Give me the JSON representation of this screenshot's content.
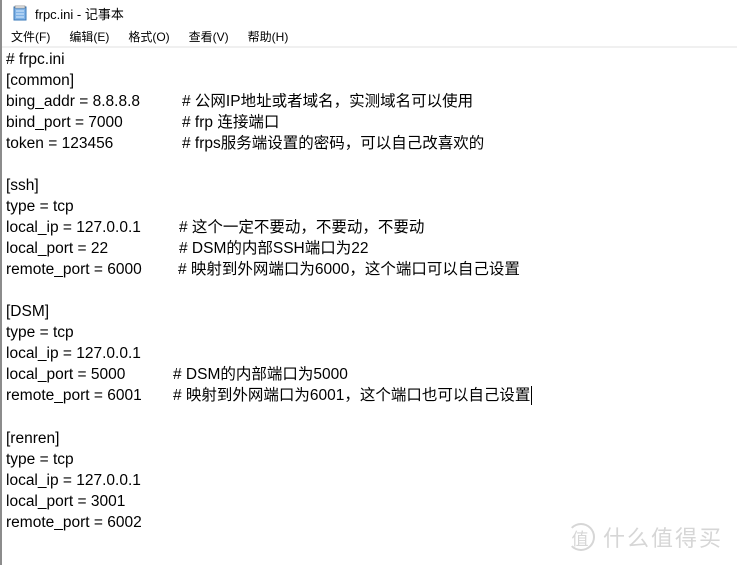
{
  "window": {
    "title": "frpc.ini - 记事本",
    "app_icon": "notepad-icon"
  },
  "menu": [
    {
      "label": "文件(F)"
    },
    {
      "label": "编辑(E)"
    },
    {
      "label": "格式(O)"
    },
    {
      "label": "查看(V)"
    },
    {
      "label": "帮助(H)"
    }
  ],
  "editor": {
    "lines": [
      {
        "text": "# frpc.ini",
        "comment": ""
      },
      {
        "text": "[common]",
        "comment": ""
      },
      {
        "text": "bing_addr = 8.8.8.8",
        "comment": "# 公网IP地址或者域名，实测域名可以使用"
      },
      {
        "text": "bind_port = 7000",
        "comment": "# frp 连接端口"
      },
      {
        "text": "token = 123456",
        "comment": "# frps服务端设置的密码，可以自己改喜欢的"
      },
      {
        "text": "",
        "comment": ""
      },
      {
        "text": "[ssh]",
        "comment": ""
      },
      {
        "text": "type = tcp",
        "comment": ""
      },
      {
        "text": "local_ip = 127.0.0.1",
        "comment": "# 这个一定不要动，不要动，不要动"
      },
      {
        "text": "local_port = 22",
        "comment": "# DSM的内部SSH端口为22"
      },
      {
        "text": "remote_port = 6000",
        "comment": "# 映射到外网端口为6000，这个端口可以自己设置"
      },
      {
        "text": "",
        "comment": ""
      },
      {
        "text": "[DSM]",
        "comment": ""
      },
      {
        "text": "type = tcp",
        "comment": ""
      },
      {
        "text": "local_ip = 127.0.0.1",
        "comment": ""
      },
      {
        "text": "local_port = 5000",
        "comment": "# DSM的内部端口为5000"
      },
      {
        "text": "remote_port = 6001",
        "comment": "# 映射到外网端口为6001，这个端口也可以自己设置"
      },
      {
        "text": "",
        "comment": ""
      },
      {
        "text": "[renren]",
        "comment": ""
      },
      {
        "text": "type = tcp",
        "comment": ""
      },
      {
        "text": "local_ip = 127.0.0.1",
        "comment": ""
      },
      {
        "text": "local_port = 3001",
        "comment": ""
      },
      {
        "text": "remote_port = 6002",
        "comment": ""
      }
    ]
  },
  "watermark": {
    "badge": "值",
    "text": "什么值得买"
  }
}
